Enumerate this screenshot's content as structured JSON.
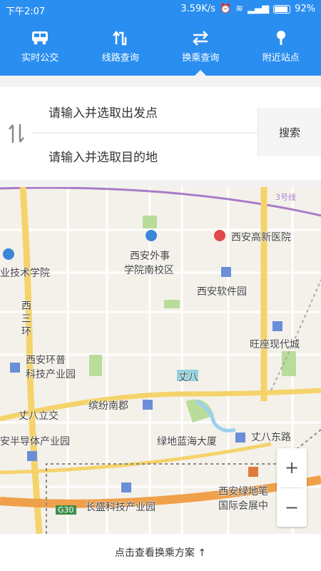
{
  "status_bar": {
    "time": "下午2:07",
    "network_speed": "3.59K/s",
    "battery": "92%"
  },
  "nav": {
    "items": [
      {
        "label": "实时公交",
        "icon": "bus-icon"
      },
      {
        "label": "线路查询",
        "icon": "route-icon"
      },
      {
        "label": "换乘查询",
        "icon": "transfer-icon"
      },
      {
        "label": "附近站点",
        "icon": "location-pin-icon"
      }
    ],
    "active_index": 2
  },
  "search": {
    "origin_placeholder": "请输入并选取出发点",
    "destination_placeholder": "请输入并选取目的地",
    "search_label": "搜索"
  },
  "map": {
    "labels": {
      "l1": "西安外事",
      "l2": "学院南校区",
      "l3": "西安高新医院",
      "l4": "业技术学院",
      "l5": "西安软件园",
      "l6": "西",
      "l7": "三",
      "l8": "环",
      "l9": "旺座现代城",
      "l10": "西安环普",
      "l11": "科技产业园",
      "l12": "丈八",
      "l13": "丈八立交",
      "l14": "缤纷南郡",
      "l15": "安半导体产业园",
      "l16": "绿地蓝海大厦",
      "l17": "丈八东路",
      "l18": "西安绿地笔",
      "l19": "国际会展中",
      "l20": "长盛科技产业园",
      "l21": "G30",
      "l22": "3号线"
    },
    "zoom_in": "+",
    "zoom_out": "−"
  },
  "bottom_bar": {
    "label": "点击查看换乘方案 ↑"
  },
  "colors": {
    "primary": "#2a8ef0",
    "map_background": "#f4f1ea",
    "road_yellow": "#f5d36b",
    "highway_orange": "#f0a04b",
    "metro_purple": "#a87cc8"
  }
}
